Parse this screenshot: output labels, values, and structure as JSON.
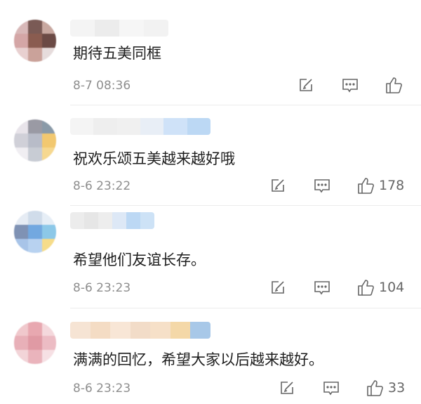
{
  "comments": [
    {
      "text": "期待五美同框",
      "time": "8-7 08:36",
      "likes": "",
      "avatar_colors": [
        "#d8b8b8",
        "#7a5a55",
        "#c8a8a0",
        "#d4a6a6",
        "#8a5c50",
        "#6b4a45",
        "#e8d0d0",
        "#caa29a",
        "#e6dcdc"
      ],
      "name_colors": [
        "#f4f4f4",
        "#ececec",
        "#f6f6f6",
        "#f2f2f2"
      ]
    },
    {
      "text": "祝欢乐颂五美越来越好哦",
      "time": "8-6 23:22",
      "likes": "178",
      "avatar_colors": [
        "#e8e4ea",
        "#9a9aa4",
        "#8a9aa8",
        "#d0d0d8",
        "#b8bcc8",
        "#f2c870",
        "#f0eef2",
        "#c8ccd4",
        "#f6d890"
      ],
      "name_colors": [
        "#f4f4f4",
        "#eeeeee",
        "#f0f0f0",
        "#e8eef6",
        "#cfe2f8",
        "#bcd8f4"
      ]
    },
    {
      "text": "希望他们友谊长存。",
      "time": "8-6 23:23",
      "likes": "104",
      "avatar_colors": [
        "#e6ecf4",
        "#d0dcea",
        "#e6eef6",
        "#7f92b4",
        "#72a8e0",
        "#8cc8e8",
        "#a8c4e8",
        "#b8d2f0",
        "#f6dc8a"
      ],
      "name_colors": [
        "#ececec",
        "#e6e6e6",
        "#ededed",
        "#dde8f6",
        "#bcd8f4",
        "#cde2f6"
      ]
    },
    {
      "text": "满满的回忆，希望大家以后越来越好。",
      "time": "8-6 23:23",
      "likes": "33",
      "avatar_colors": [
        "#f0c8cc",
        "#e8a8b0",
        "#f4d8dc",
        "#e8b0b8",
        "#e09aa4",
        "#ecbcc4",
        "#f2d4d8",
        "#eab4bc",
        "#f6e0e4"
      ],
      "name_colors": [
        "#f6e4d4",
        "#f4dcc4",
        "#f8e6d6",
        "#f2dcc8",
        "#f6e0c8",
        "#f4d8a8",
        "#a8c8e8"
      ]
    }
  ],
  "icons": {
    "reply": "reply-icon",
    "comment": "comment-icon",
    "like": "thumbs-up-icon"
  }
}
